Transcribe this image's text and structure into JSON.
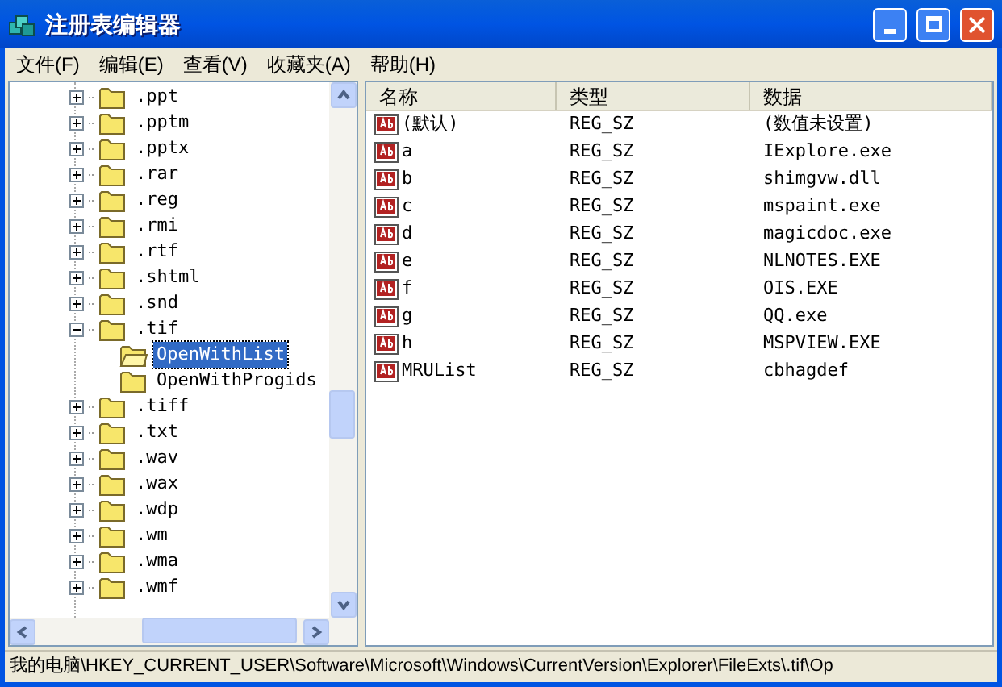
{
  "window": {
    "title": "注册表编辑器"
  },
  "menu": [
    "文件(F)",
    "编辑(E)",
    "查看(V)",
    "收藏夹(A)",
    "帮助(H)"
  ],
  "tree": [
    {
      "label": ".ppt",
      "expanded": false,
      "selected": false
    },
    {
      "label": ".pptm",
      "expanded": false,
      "selected": false
    },
    {
      "label": ".pptx",
      "expanded": false,
      "selected": false
    },
    {
      "label": ".rar",
      "expanded": false,
      "selected": false
    },
    {
      "label": ".reg",
      "expanded": false,
      "selected": false
    },
    {
      "label": ".rmi",
      "expanded": false,
      "selected": false
    },
    {
      "label": ".rtf",
      "expanded": false,
      "selected": false
    },
    {
      "label": ".shtml",
      "expanded": false,
      "selected": false
    },
    {
      "label": ".snd",
      "expanded": false,
      "selected": false
    },
    {
      "label": ".tif",
      "expanded": true,
      "selected": false,
      "children": [
        {
          "label": "OpenWithList",
          "selected": true
        },
        {
          "label": "OpenWithProgids",
          "selected": false
        }
      ]
    },
    {
      "label": ".tiff",
      "expanded": false,
      "selected": false
    },
    {
      "label": ".txt",
      "expanded": false,
      "selected": false
    },
    {
      "label": ".wav",
      "expanded": false,
      "selected": false
    },
    {
      "label": ".wax",
      "expanded": false,
      "selected": false
    },
    {
      "label": ".wdp",
      "expanded": false,
      "selected": false
    },
    {
      "label": ".wm",
      "expanded": false,
      "selected": false
    },
    {
      "label": ".wma",
      "expanded": false,
      "selected": false
    },
    {
      "label": ".wmf",
      "expanded": false,
      "selected": false
    }
  ],
  "columns": [
    "名称",
    "类型",
    "数据"
  ],
  "values": [
    {
      "name": "(默认)",
      "type": "REG_SZ",
      "data": "(数值未设置)"
    },
    {
      "name": "a",
      "type": "REG_SZ",
      "data": "IExplore.exe"
    },
    {
      "name": "b",
      "type": "REG_SZ",
      "data": "shimgvw.dll"
    },
    {
      "name": "c",
      "type": "REG_SZ",
      "data": "mspaint.exe"
    },
    {
      "name": "d",
      "type": "REG_SZ",
      "data": "magicdoc.exe"
    },
    {
      "name": "e",
      "type": "REG_SZ",
      "data": "NLNOTES.EXE"
    },
    {
      "name": "f",
      "type": "REG_SZ",
      "data": "OIS.EXE"
    },
    {
      "name": "g",
      "type": "REG_SZ",
      "data": "QQ.exe"
    },
    {
      "name": "h",
      "type": "REG_SZ",
      "data": "MSPVIEW.EXE"
    },
    {
      "name": "MRUList",
      "type": "REG_SZ",
      "data": "cbhagdef"
    }
  ],
  "status_bar": "我的电脑\\HKEY_CURRENT_USER\\Software\\Microsoft\\Windows\\CurrentVersion\\Explorer\\FileExts\\.tif\\Op"
}
